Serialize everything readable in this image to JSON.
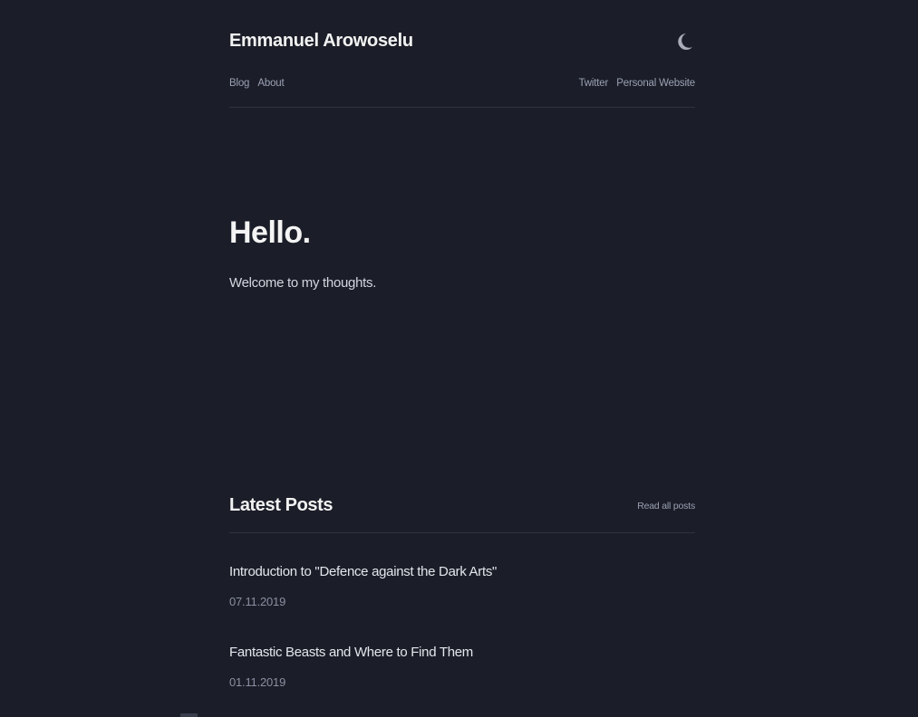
{
  "header": {
    "site_title": "Emmanuel Arowoselu",
    "theme_toggle_icon": "moon-icon",
    "nav_left": [
      {
        "label": "Blog"
      },
      {
        "label": "About"
      }
    ],
    "nav_right": [
      {
        "label": "Twitter"
      },
      {
        "label": "Personal Website"
      }
    ]
  },
  "hero": {
    "title": "Hello.",
    "subtitle": "Welcome to my thoughts."
  },
  "latest": {
    "title": "Latest Posts",
    "read_all_label": "Read all posts",
    "posts": [
      {
        "title": "Introduction to \"Defence against the Dark Arts\"",
        "date": "07.11.2019"
      },
      {
        "title": "Fantastic Beasts and Where to Find Them",
        "date": "01.11.2019"
      }
    ]
  },
  "colors": {
    "background": "#1b1e28",
    "text_primary": "#f2f2f2",
    "text_muted": "#9aa0b4",
    "divider": "#2f3342"
  }
}
